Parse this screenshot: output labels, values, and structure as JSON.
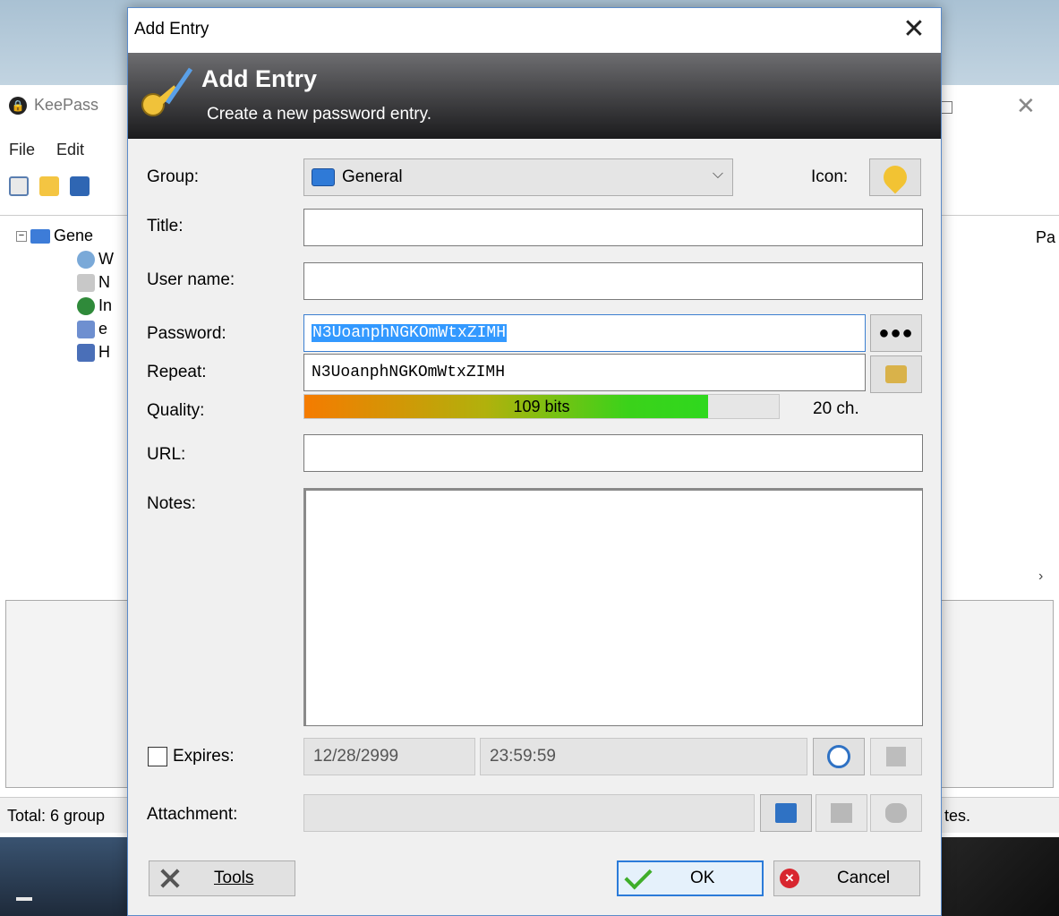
{
  "main_window": {
    "title": "KeePass",
    "menu": [
      "File",
      "Edit"
    ],
    "tree": {
      "root_label": "Gene",
      "children": [
        "W",
        "N",
        "In",
        "e",
        "H"
      ]
    },
    "list_column_head": "Pa",
    "status_left": "Total: 6 group",
    "status_right": "tes."
  },
  "dialog": {
    "window_title": "Add Entry",
    "close_symbol": "✕",
    "banner": {
      "title": "Add Entry",
      "subtitle": "Create a new password entry."
    },
    "group": {
      "label": "Group:",
      "value": "General",
      "icon_label": "Icon:"
    },
    "title_field": {
      "label": "Title:",
      "value": ""
    },
    "username_field": {
      "label": "User name:",
      "value": ""
    },
    "password_field": {
      "label": "Password:",
      "value": "N3UoanphNGKOmWtxZIMH"
    },
    "repeat_field": {
      "label": "Repeat:",
      "value": "N3UoanphNGKOmWtxZIMH"
    },
    "show_password_button": "●●●",
    "quality": {
      "label": "Quality:",
      "bits_text": "109 bits",
      "fraction": 0.85,
      "chars_text": "20 ch."
    },
    "url_field": {
      "label": "URL:",
      "value": ""
    },
    "notes_field": {
      "label": "Notes:",
      "value": ""
    },
    "expires": {
      "label": "Expires:",
      "checked": false,
      "date": "12/28/2999",
      "time": "23:59:59"
    },
    "attachment": {
      "label": "Attachment:",
      "value": ""
    },
    "buttons": {
      "tools": "Tools",
      "ok": "OK",
      "cancel": "Cancel"
    }
  }
}
